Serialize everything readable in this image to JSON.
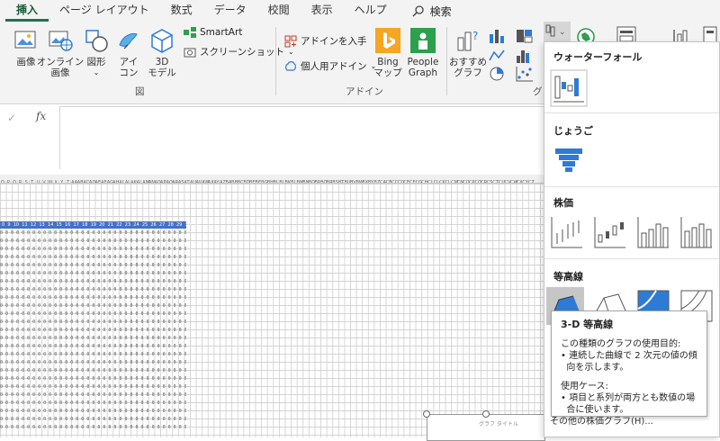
{
  "tabs": [
    "挿入",
    "ページ レイアウト",
    "数式",
    "データ",
    "校閲",
    "表示",
    "ヘルプ"
  ],
  "tell_me": "検索",
  "ribbon": {
    "image": "画像",
    "online_image": "オンライン\n画像",
    "shapes": "図形",
    "icons": "アイ\nコン",
    "model3d": "3D\nモデル",
    "smartart": "SmartArt",
    "screenshot": "スクリーンショット",
    "group_figures": "図",
    "get_addins": "アドインを入手",
    "my_addins": "個人用アドイン",
    "bing": "Bing\nマップ",
    "people": "People\nGraph",
    "group_addins": "アドイン",
    "recommended": "おすすめ\nグラフ",
    "group_graph_partial": "グ"
  },
  "sheet": {
    "columns": [
      "O",
      "P",
      "Q",
      "R",
      "S",
      "T",
      "U",
      "V",
      "W",
      "X",
      "Y",
      "Z",
      "AA",
      "AB",
      "AC",
      "AD",
      "AE",
      "AF",
      "AG",
      "AH",
      "AI",
      "AJ",
      "AK",
      "AL",
      "AM",
      "AN",
      "AO",
      "AP",
      "AQ",
      "AR",
      "AS",
      "AT",
      "AU",
      "AV",
      "AW",
      "AX",
      "AY",
      "AZ",
      "BA",
      "BB",
      "BC",
      "BD",
      "BE",
      "BF",
      "BG",
      "BH",
      "BI",
      "BJ",
      "BK",
      "BL",
      "BM",
      "BN",
      "BO",
      "BP",
      "BQ",
      "BR",
      "BS",
      "BT",
      "BU",
      "BV",
      "BW",
      "BX",
      "BY",
      "BZ",
      "CA",
      "CB",
      "CC",
      "CD",
      "CE",
      "CF",
      "CG",
      "CH",
      "CI",
      "CJ",
      "CK",
      "CL",
      "CM",
      "CN",
      "CO",
      "CP",
      "CQ",
      "CR",
      "CS",
      "CT",
      "CU",
      "CV",
      "CW",
      "CX",
      "CY",
      "CZ"
    ],
    "header_numbers": "0  9  10  11  12  13  14  15  16  17  18  19  20  21  22  23  24  25  26  27  28  29  30  31",
    "zero_row": "0 0 0 0 0 0 0 0 0 0 0 0 0 0 0 0 0 0 0 0 0 0 0 0 0 0 0 0 0 0 0 0 0 0 0 0",
    "chart_title": "グラフ タイトル"
  },
  "dropdown": {
    "waterfall": "ウォーターフォール",
    "funnel": "じょうご",
    "stock": "株価",
    "surface": "等高線"
  },
  "tooltip": {
    "title": "3-D 等高線",
    "purpose_head": "この種類のグラフの使用目的:",
    "purpose_body": "• 連続した曲線で 2 次元の値の傾\n  向を示します。",
    "use_head": "使用ケース:",
    "use_body": "• 項目と系列が両方とも数値の場\n  合に使います。"
  },
  "more_charts": "その他の株価グラフ(H)...",
  "colors": {
    "accent": "#217346",
    "highlight": "#4472c4",
    "chart_blue": "#2e7bd6"
  }
}
